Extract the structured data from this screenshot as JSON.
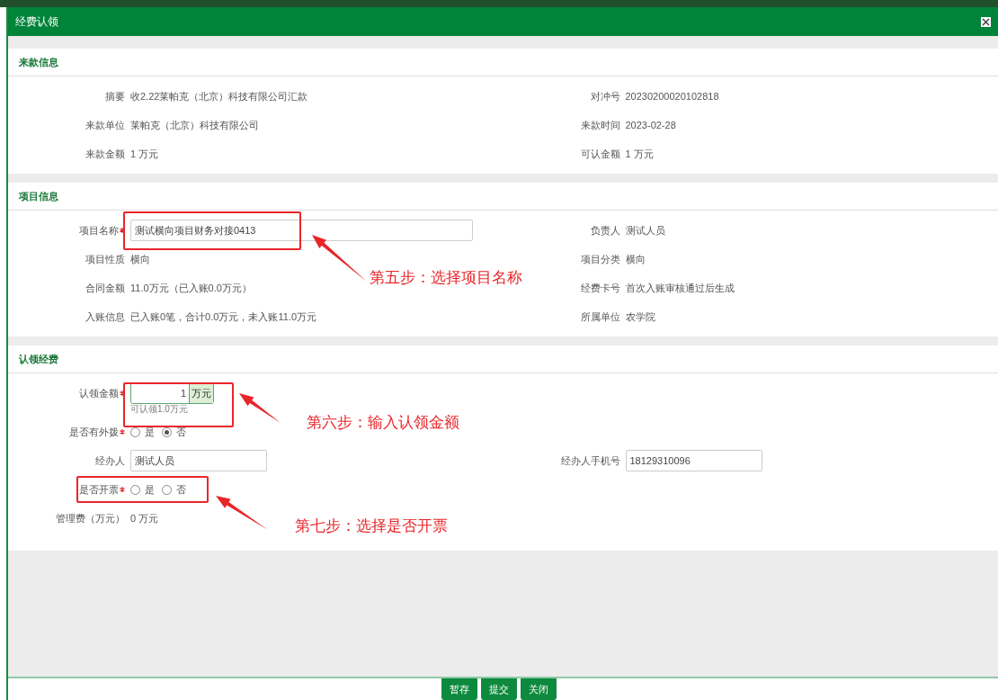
{
  "dialog": {
    "title": "经费认领"
  },
  "income": {
    "title": "来款信息",
    "rows": [
      [
        {
          "label": "摘要",
          "value": "收2.22莱帕克（北京）科技有限公司汇款"
        },
        {
          "label": "对冲号",
          "value": "20230200020102818"
        }
      ],
      [
        {
          "label": "来款单位",
          "value": "莱帕克（北京）科技有限公司"
        },
        {
          "label": "来款时间",
          "value": "2023-02-28"
        }
      ],
      [
        {
          "label": "来款金额",
          "value": "1 万元"
        },
        {
          "label": "可认金额",
          "value": "1 万元"
        }
      ]
    ]
  },
  "project": {
    "title": "项目信息",
    "rows": [
      [
        {
          "kind": "input",
          "label": "项目名称",
          "required": true,
          "value": "测试横向项目财务对接0413"
        },
        {
          "kind": "text",
          "label": "负责人",
          "value": "测试人员"
        }
      ],
      [
        {
          "kind": "text",
          "label": "项目性质",
          "value": "横向"
        },
        {
          "kind": "text",
          "label": "项目分类",
          "value": "横向"
        }
      ],
      [
        {
          "kind": "text",
          "label": "合同金额",
          "value": "11.0万元（已入账0.0万元）"
        },
        {
          "kind": "text",
          "label": "经费卡号",
          "value": "首次入账审核通过后生成"
        }
      ],
      [
        {
          "kind": "text",
          "label": "入账信息",
          "value": "已入账0笔，合计0.0万元，未入账11.0万元"
        },
        {
          "kind": "text",
          "label": "所属单位",
          "value": "农学院"
        }
      ]
    ]
  },
  "claim": {
    "title": "认领经费",
    "rows": [
      [
        {
          "kind": "amount",
          "label": "认领金额",
          "required": true,
          "value": "1",
          "unit": "万元",
          "hint": "可认领1.0万元"
        }
      ],
      [
        {
          "kind": "radio",
          "label": "是否有外拨",
          "required": true,
          "options": [
            {
              "label": "是",
              "selected": false
            },
            {
              "label": "否",
              "selected": true
            }
          ]
        }
      ],
      [
        {
          "kind": "input",
          "label": "经办人",
          "value": "测试人员"
        },
        {
          "kind": "input",
          "label": "经办人手机号",
          "value": "18129310096"
        }
      ],
      [
        {
          "kind": "radio",
          "label": "是否开票",
          "required": true,
          "options": [
            {
              "label": "是",
              "selected": false
            },
            {
              "label": "否",
              "selected": false
            }
          ]
        }
      ],
      [
        {
          "kind": "text",
          "label": "管理费（万元）",
          "value": "0 万元"
        }
      ]
    ]
  },
  "buttons": [
    "暂存",
    "提交",
    "关闭"
  ],
  "annotations": [
    {
      "text": "第五步：选择项目名称"
    },
    {
      "text": "第六步：输入认领金额"
    },
    {
      "text": "第七步：选择是否开票"
    }
  ]
}
